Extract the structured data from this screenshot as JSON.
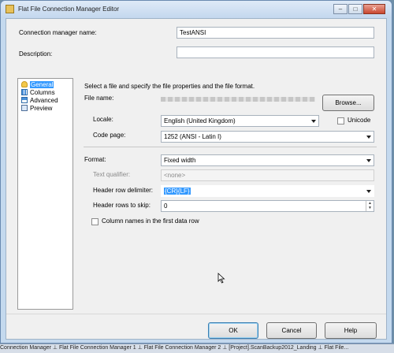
{
  "window": {
    "title": "Flat File Connection Manager Editor",
    "controls": {
      "minimize": "–",
      "maximize": "□",
      "close": "✕"
    }
  },
  "fields": {
    "connection_name_label": "Connection manager name:",
    "connection_name_value": "TestANSI",
    "description_label": "Description:",
    "description_value": ""
  },
  "nav": {
    "items": [
      {
        "label": "General",
        "icon": "general-icon",
        "selected": true
      },
      {
        "label": "Columns",
        "icon": "columns-icon",
        "selected": false
      },
      {
        "label": "Advanced",
        "icon": "advanced-icon",
        "selected": false
      },
      {
        "label": "Preview",
        "icon": "preview-icon",
        "selected": false
      }
    ]
  },
  "general": {
    "instruction": "Select a file and specify the file properties and the file format.",
    "file_name_label": "File name:",
    "browse_label": "Browse...",
    "locale_label": "Locale:",
    "locale_value": "English (United Kingdom)",
    "unicode_label": "Unicode",
    "unicode_checked": false,
    "code_page_label": "Code page:",
    "code_page_value": "1252  (ANSI - Latin I)",
    "format_label": "Format:",
    "format_value": "Fixed width",
    "text_qualifier_label": "Text qualifier:",
    "text_qualifier_value": "<none>",
    "header_row_delimiter_label": "Header row delimiter:",
    "header_row_delimiter_value": "{CR}{LF}",
    "header_rows_skip_label": "Header rows to skip:",
    "header_rows_skip_value": "0",
    "column_names_label": "Column names in the first data row",
    "column_names_checked": false
  },
  "buttons": {
    "ok": "OK",
    "cancel": "Cancel",
    "help": "Help"
  },
  "taskbar": {
    "text": "Connection Manager   ⊥  Flat File Connection Manager 1   ⊥  Flat File Connection Manager 2   ⊥  [Project].ScanBackup2012_Landing   ⊥  Flat File..."
  }
}
